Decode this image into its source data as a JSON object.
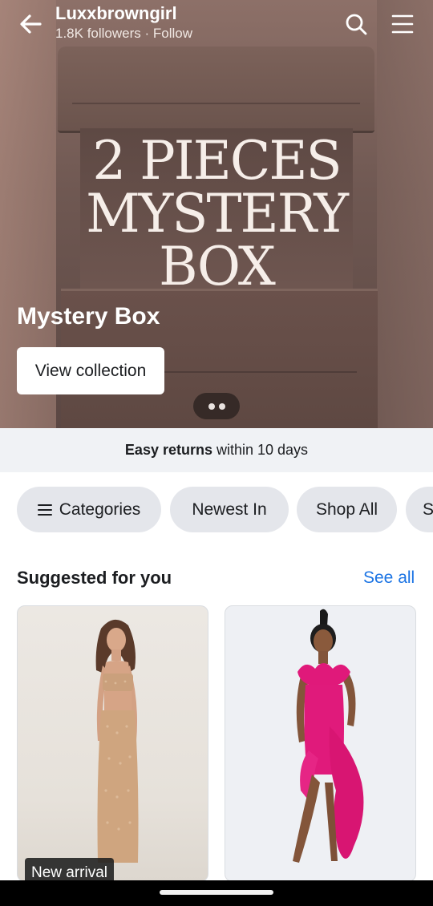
{
  "header": {
    "page_name": "Luxxbrowngirl",
    "meta": "1.8K followers · Follow",
    "back_icon": "arrow-left-icon",
    "search_icon": "search-icon",
    "menu_icon": "menu-icon"
  },
  "hero": {
    "image_text_line1": "2 PIECES",
    "image_text_line2": "MYSTERY",
    "image_text_line3": "BOX",
    "collection_title": "Mystery Box",
    "view_button": "View collection",
    "pager_dots": 2
  },
  "returns": {
    "bold": "Easy returns",
    "rest": "within 10 days"
  },
  "chips": [
    {
      "label": "Categories",
      "icon": "menu-icon"
    },
    {
      "label": "Newest In"
    },
    {
      "label": "Shop All"
    },
    {
      "label": "S"
    }
  ],
  "suggested": {
    "title": "Suggested for you",
    "see_all": "See all",
    "cards": [
      {
        "badge": "New arrival"
      },
      {
        "badge": ""
      }
    ]
  },
  "colors": {
    "link": "#1b74e4",
    "chip_bg": "#e4e6eb",
    "strip_bg": "#f0f2f5"
  }
}
